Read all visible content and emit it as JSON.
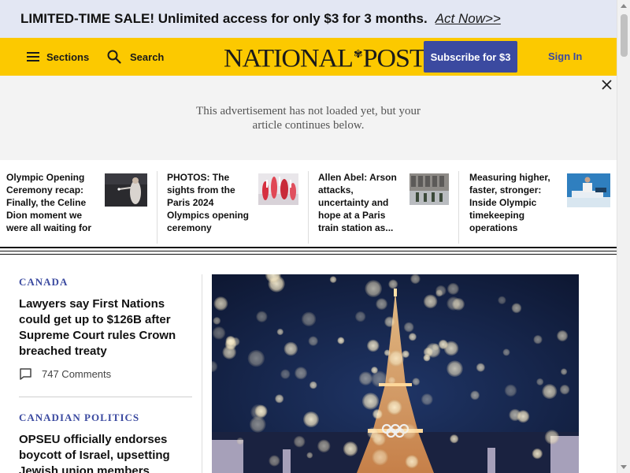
{
  "promo": {
    "message": "LIMITED-TIME SALE! Unlimited access for only $3 for 3 months.",
    "cta": "Act Now>>"
  },
  "header": {
    "sections_label": "Sections",
    "search_label": "Search",
    "logo_left": "NATIONAL",
    "logo_right": "POST",
    "subscribe_label": "Subscribe for $3",
    "signin_label": "Sign In",
    "brand_color": "#fcc900",
    "accent_color": "#3b4aa0"
  },
  "ad": {
    "line1": "This advertisement has not loaded yet, but your",
    "line2": "article continues below."
  },
  "strip": {
    "items": [
      {
        "title": "Olympic Opening Ceremony recap: Finally, the Celine Dion moment we were all waiting for"
      },
      {
        "title": "PHOTOS: The sights from the Paris 2024 Olympics opening ceremony"
      },
      {
        "title": "Allen Abel: Arson attacks, uncertainty and hope at a Paris train station as..."
      },
      {
        "title": "Measuring higher, faster, stronger: Inside Olympic timekeeping operations"
      }
    ]
  },
  "sidebar": {
    "stories": [
      {
        "kicker": "Canada",
        "headline": "Lawyers say First Nations could get up to $126B after Supreme Court rules Crown breached treaty",
        "comments": "747 Comments"
      },
      {
        "kicker": "Canadian Politics",
        "headline": "OPSEU officially endorses boycott of Israel, upsetting Jewish union members"
      }
    ]
  }
}
